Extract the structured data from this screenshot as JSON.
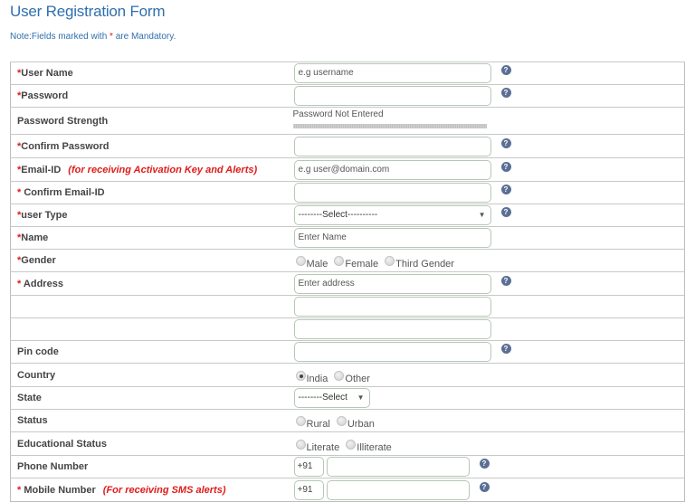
{
  "header": {
    "title": "User Registration Form",
    "note_prefix": "Note:Fields marked with ",
    "note_star": "*",
    "note_suffix": " are Mandatory."
  },
  "colors": {
    "title": "#2f6fad",
    "mandatory": "#e01a1a",
    "help_icon": "#5b6f95"
  },
  "help_icon": {
    "name": "question-circle-icon",
    "glyph": "?"
  },
  "star": "*",
  "fields": {
    "username": {
      "label": "User Name",
      "placeholder": "e.g username"
    },
    "password": {
      "label": "Password",
      "value": ""
    },
    "password_strength": {
      "label": "Password Strength",
      "status": "Password Not Entered",
      "strength_percent": 0
    },
    "confirm_password": {
      "label": "Confirm Password",
      "value": ""
    },
    "email": {
      "label": "Email-ID",
      "hint": "(for receiving Activation Key and Alerts)",
      "placeholder": "e.g user@domain.com"
    },
    "confirm_email": {
      "label": " Confirm Email-ID",
      "value": ""
    },
    "user_type": {
      "label": "user Type",
      "selected": "--------Select----------"
    },
    "name": {
      "label": "Name",
      "placeholder": "Enter Name"
    },
    "gender": {
      "label": "Gender",
      "options": [
        "Male",
        "Female",
        "Third Gender"
      ],
      "selected": null
    },
    "address": {
      "label": " Address",
      "placeholder": "Enter address",
      "line2": "",
      "line3": ""
    },
    "pincode": {
      "label": "Pin code",
      "value": ""
    },
    "country": {
      "label": "Country",
      "options": [
        "India",
        "Other"
      ],
      "selected": "India"
    },
    "state": {
      "label": "State",
      "selected": "--------Select"
    },
    "status": {
      "label": "Status",
      "options": [
        "Rural",
        "Urban"
      ],
      "selected": null
    },
    "education": {
      "label": "Educational Status",
      "options": [
        "Literate",
        "Illiterate"
      ],
      "selected": null
    },
    "phone": {
      "label": "Phone Number",
      "prefix": "+91",
      "value": ""
    },
    "mobile": {
      "label": " Mobile Number",
      "hint": "(For receiving SMS alerts)",
      "prefix": "+91",
      "value": ""
    }
  },
  "select_arrow": "▼"
}
